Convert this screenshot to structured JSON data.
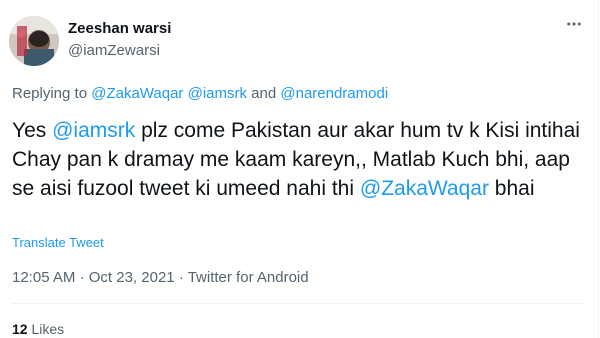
{
  "author": {
    "name": "Zeeshan warsi",
    "handle": "@iamZewarsi"
  },
  "reply": {
    "prefix": "Replying to",
    "mention_1": "@ZakaWaqar",
    "mention_2": "@iamsrk",
    "and_word": "and",
    "mention_3": "@narendramodi"
  },
  "tweet": {
    "text_1": "Yes",
    "mention_a": "@iamsrk",
    "text_2": "plz come Pakistan aur akar hum tv k Kisi intihai Chay pan k dramay me kaam kareyn,, Matlab Kuch bhi, aap se aisi fuzool tweet ki umeed nahi thi",
    "mention_b": "@ZakaWaqar",
    "text_3": "bhai",
    "translate_label": "Translate Tweet"
  },
  "meta": {
    "time": "12:05 AM",
    "separator_1": "·",
    "date": "Oct 23, 2021",
    "separator_2": "·",
    "source": "Twitter for Android"
  },
  "stats": {
    "likes_count": "12",
    "likes_label": "Likes"
  },
  "icons": {
    "more": "more-icon",
    "avatar": "avatar-image"
  },
  "colors": {
    "link": "#1d9bf0",
    "secondary_text": "#536471",
    "primary_text": "#0f1419",
    "divider": "#eff3f4"
  }
}
